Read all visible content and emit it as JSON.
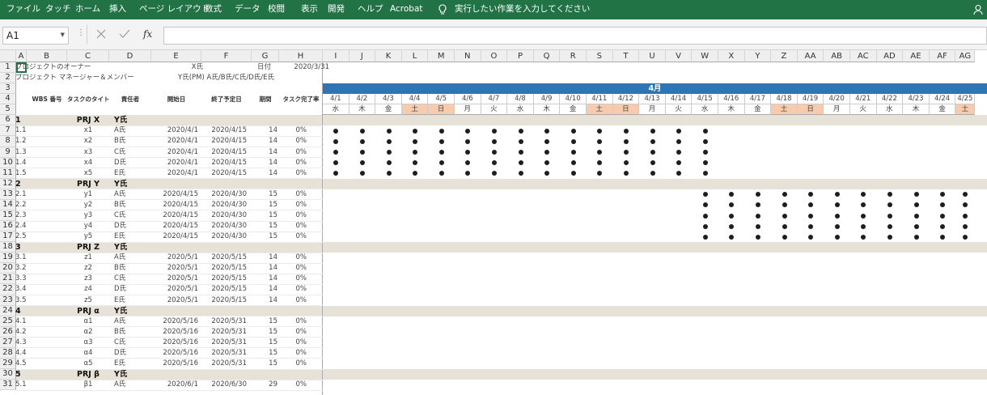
{
  "ribbon": {
    "tabs": [
      "ファイル",
      "タッチ",
      "ホーム",
      "挿入",
      "ページ レイアウト",
      "数式",
      "データ",
      "校閲",
      "表示",
      "開発",
      "ヘルプ",
      "Acrobat"
    ],
    "tell_me": "実行したい作業を入力してください"
  },
  "formula_bar": {
    "name_box": "A1",
    "formula": ""
  },
  "columns": [
    "A",
    "B",
    "C",
    "D",
    "E",
    "F",
    "G",
    "H",
    "I",
    "J",
    "K",
    "L",
    "M",
    "N",
    "O",
    "P",
    "Q",
    "R",
    "S",
    "T",
    "U",
    "V",
    "W",
    "X",
    "Y",
    "Z",
    "AA",
    "AB",
    "AC",
    "AD",
    "AE",
    "AF",
    "AG"
  ],
  "rows": [
    "1",
    "2",
    "3",
    "4",
    "5",
    "6",
    "7",
    "8",
    "9",
    "10",
    "11",
    "12",
    "13",
    "14",
    "15",
    "16",
    "17",
    "18",
    "19",
    "20",
    "21",
    "22",
    "23",
    "24",
    "25",
    "26",
    "27",
    "28",
    "29",
    "30",
    "31"
  ],
  "header": {
    "owner_label": "プロジェクトのオーナー",
    "owner": "X氏",
    "date_label": "日付",
    "date": "2020/3/31",
    "members_label": "プロジェクト マネージャー＆メンバー",
    "members": "Y氏(PM) A氏/B氏/C氏/D氏/E氏"
  },
  "table_headers": [
    "WBS 番号",
    "タスクのタイトル",
    "責任者",
    "開始日",
    "終了予定日",
    "期間",
    "タスク完了率"
  ],
  "month": "4月",
  "dates": [
    "4/1",
    "4/2",
    "4/3",
    "4/4",
    "4/5",
    "4/6",
    "4/7",
    "4/8",
    "4/9",
    "4/10",
    "4/11",
    "4/12",
    "4/13",
    "4/14",
    "4/15",
    "4/16",
    "4/17",
    "4/18",
    "4/19",
    "4/20",
    "4/21",
    "4/22",
    "4/23",
    "4/24",
    "4/25"
  ],
  "weekdays": [
    "水",
    "木",
    "金",
    "土",
    "日",
    "月",
    "火",
    "水",
    "木",
    "金",
    "土",
    "日",
    "月",
    "火",
    "水",
    "木",
    "金",
    "土",
    "日",
    "月",
    "火",
    "水",
    "木",
    "金",
    "土"
  ],
  "weekend_indices": [
    3,
    4,
    10,
    11,
    17,
    18,
    24
  ],
  "colors": {
    "ribbon": "#217346",
    "month_bar": "#2e75b6",
    "group_row": "#e7e2d8",
    "weekend": "#f8cbad",
    "dot": "#1e1e1e"
  },
  "groups": [
    {
      "no": "1",
      "title": "PRJ X",
      "owner": "Y氏",
      "tasks": [
        [
          "1.1",
          "x1",
          "A氏",
          "2020/4/1",
          "2020/4/15",
          "14",
          "0%"
        ],
        [
          "1.2",
          "x2",
          "B氏",
          "2020/4/1",
          "2020/4/15",
          "14",
          "0%"
        ],
        [
          "1.3",
          "x3",
          "C氏",
          "2020/4/1",
          "2020/4/15",
          "14",
          "0%"
        ],
        [
          "1.4",
          "x4",
          "D氏",
          "2020/4/1",
          "2020/4/15",
          "14",
          "0%"
        ],
        [
          "1.5",
          "x5",
          "E氏",
          "2020/4/1",
          "2020/4/15",
          "14",
          "0%"
        ]
      ]
    },
    {
      "no": "2",
      "title": "PRJ Y",
      "owner": "Y氏",
      "tasks": [
        [
          "2.1",
          "y1",
          "A氏",
          "2020/4/15",
          "2020/4/30",
          "15",
          "0%"
        ],
        [
          "2.2",
          "y2",
          "B氏",
          "2020/4/15",
          "2020/4/30",
          "15",
          "0%"
        ],
        [
          "2.3",
          "y3",
          "C氏",
          "2020/4/15",
          "2020/4/30",
          "15",
          "0%"
        ],
        [
          "2.4",
          "y4",
          "D氏",
          "2020/4/15",
          "2020/4/30",
          "15",
          "0%"
        ],
        [
          "2.5",
          "y5",
          "E氏",
          "2020/4/15",
          "2020/4/30",
          "15",
          "0%"
        ]
      ]
    },
    {
      "no": "3",
      "title": "PRJ Z",
      "owner": "Y氏",
      "tasks": [
        [
          "3.1",
          "z1",
          "A氏",
          "2020/5/1",
          "2020/5/15",
          "14",
          "0%"
        ],
        [
          "3.2",
          "z2",
          "B氏",
          "2020/5/1",
          "2020/5/15",
          "14",
          "0%"
        ],
        [
          "3.3",
          "z3",
          "C氏",
          "2020/5/1",
          "2020/5/15",
          "14",
          "0%"
        ],
        [
          "3.4",
          "z4",
          "D氏",
          "2020/5/1",
          "2020/5/15",
          "14",
          "0%"
        ],
        [
          "3.5",
          "z5",
          "E氏",
          "2020/5/1",
          "2020/5/15",
          "14",
          "0%"
        ]
      ]
    },
    {
      "no": "4",
      "title": "PRJ α",
      "owner": "Y氏",
      "tasks": [
        [
          "4.1",
          "α1",
          "A氏",
          "2020/5/16",
          "2020/5/31",
          "15",
          "0%"
        ],
        [
          "4.2",
          "α2",
          "B氏",
          "2020/5/16",
          "2020/5/31",
          "15",
          "0%"
        ],
        [
          "4.3",
          "α3",
          "C氏",
          "2020/5/16",
          "2020/5/31",
          "15",
          "0%"
        ],
        [
          "4.4",
          "α4",
          "D氏",
          "2020/5/16",
          "2020/5/31",
          "15",
          "0%"
        ],
        [
          "4.5",
          "α5",
          "E氏",
          "2020/5/16",
          "2020/5/31",
          "15",
          "0%"
        ]
      ]
    },
    {
      "no": "5",
      "title": "PRJ β",
      "owner": "Y氏",
      "tasks": [
        [
          "5.1",
          "β1",
          "A氏",
          "2020/6/1",
          "2020/6/30",
          "29",
          "0%"
        ]
      ]
    }
  ]
}
